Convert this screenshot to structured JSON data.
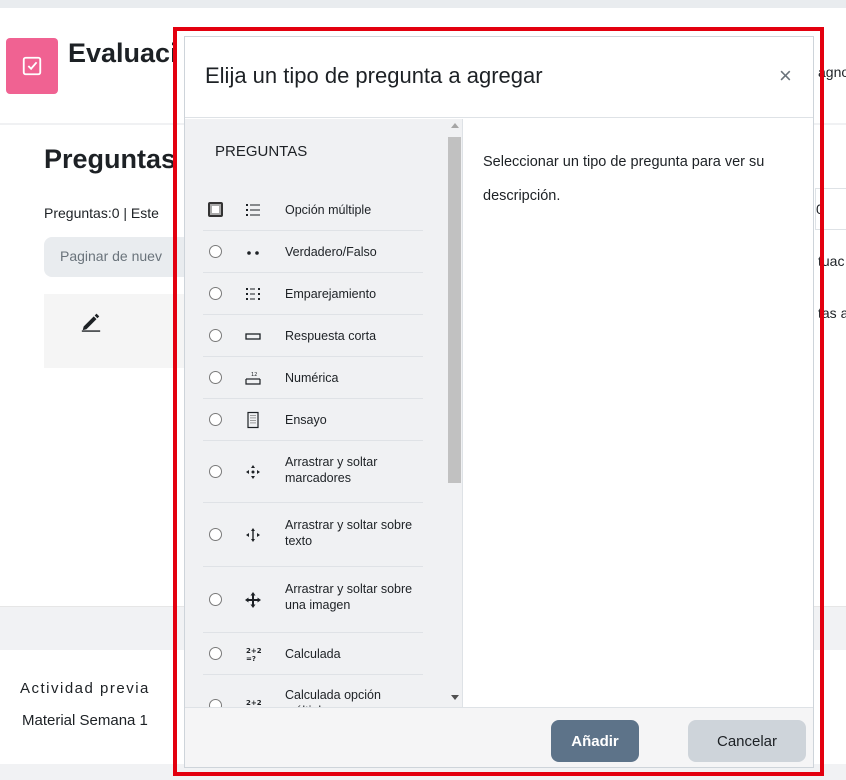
{
  "page": {
    "quiz_title": "Evaluaci",
    "right_fragments": [
      "agno",
      "tuac",
      "tas a"
    ],
    "side_value": "0",
    "section_title": "Preguntas",
    "question_count": "Preguntas:0 | Este",
    "paginate_placeholder": "Paginar de nuev",
    "previous_activity_label": "Actividad previa",
    "previous_activity_link": "Material Semana 1"
  },
  "modal": {
    "title": "Elija un tipo de pregunta a agregar",
    "close_symbol": "×",
    "section_heading": "PREGUNTAS",
    "description": "Seleccionar un tipo de pregunta para ver su descripción.",
    "add_label": "Añadir",
    "cancel_label": "Cancelar",
    "options": [
      {
        "label": "Opción múltiple",
        "icon": "multichoice-icon",
        "selected": true
      },
      {
        "label": "Verdadero/Falso",
        "icon": "truefalse-icon",
        "selected": false
      },
      {
        "label": "Emparejamiento",
        "icon": "match-icon",
        "selected": false
      },
      {
        "label": "Respuesta corta",
        "icon": "shortanswer-icon",
        "selected": false
      },
      {
        "label": "Numérica",
        "icon": "numerical-icon",
        "selected": false
      },
      {
        "label": "Ensayo",
        "icon": "essay-icon",
        "selected": false
      },
      {
        "label": "Arrastrar y soltar marcadores",
        "icon": "ddmarker-icon",
        "selected": false
      },
      {
        "label": "Arrastrar y soltar sobre texto",
        "icon": "ddwtos-icon",
        "selected": false
      },
      {
        "label": "Arrastrar y soltar sobre una imagen",
        "icon": "ddimageortext-icon",
        "selected": false
      },
      {
        "label": "Calculada",
        "icon": "calculated-icon",
        "selected": false
      },
      {
        "label": "Calculada opción múltiple",
        "icon": "calculatedmulti-icon",
        "selected": false
      }
    ]
  },
  "colors": {
    "highlight": "#e3000f",
    "quiz_icon_bg": "#f06292",
    "add_button": "#5d7389",
    "cancel_button": "#ced4da"
  }
}
